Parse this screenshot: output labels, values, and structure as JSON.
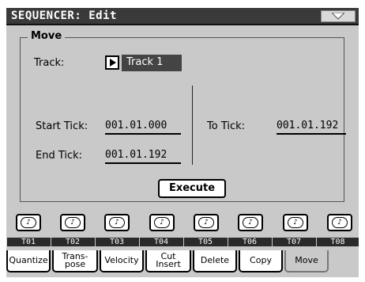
{
  "window": {
    "title": "SEQUENCER: Edit",
    "menu_icon": "triangle-down-icon"
  },
  "panel": {
    "title": "Move",
    "track_label": "Track:",
    "track_value": "Track 1",
    "start_tick_label": "Start Tick:",
    "start_tick_value": "001.01.000",
    "end_tick_label": "End Tick:",
    "end_tick_value": "001.01.192",
    "to_tick_label": "To Tick:",
    "to_tick_value": "001.01.192",
    "execute_label": "Execute"
  },
  "tracks": [
    {
      "label": "T01",
      "icon": "audio-icon"
    },
    {
      "label": "T02",
      "icon": "audio-icon"
    },
    {
      "label": "T03",
      "icon": "audio-icon"
    },
    {
      "label": "T04",
      "icon": "audio-icon"
    },
    {
      "label": "T05",
      "icon": "audio-icon"
    },
    {
      "label": "T06",
      "icon": "audio-icon"
    },
    {
      "label": "T07",
      "icon": "audio-icon"
    },
    {
      "label": "T08",
      "icon": "audio-icon"
    }
  ],
  "track_button_glyph": "♪",
  "tabs": [
    {
      "line1": "Quantize",
      "line2": ""
    },
    {
      "line1": "Trans-",
      "line2": "pose"
    },
    {
      "line1": "Velocity",
      "line2": ""
    },
    {
      "line1": "Cut",
      "line2": "Insert"
    },
    {
      "line1": "Delete",
      "line2": ""
    },
    {
      "line1": "Copy",
      "line2": ""
    },
    {
      "line1": "Move",
      "line2": ""
    }
  ]
}
